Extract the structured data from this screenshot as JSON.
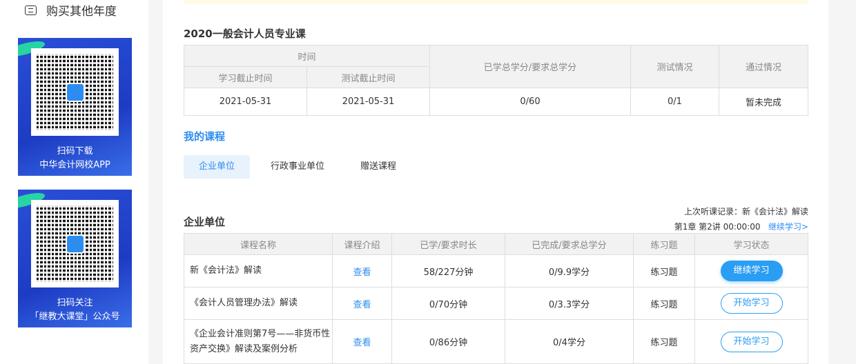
{
  "sidebar": {
    "buy_other": "购买其他年度",
    "qr1": {
      "line1": "扫码下载",
      "line2": "中华会计网校APP"
    },
    "qr2": {
      "line1": "扫码关注",
      "line2": "「继教大课堂」公众号"
    }
  },
  "summary": {
    "title": "2020一般会计人员专业课",
    "headers": {
      "time": "时间",
      "study_deadline": "学习截止时间",
      "test_deadline": "测试截止时间",
      "credits": "已学总学分/要求总学分",
      "test": "测试情况",
      "pass": "通过情况"
    },
    "row": {
      "study_deadline": "2021-05-31",
      "test_deadline": "2021-05-31",
      "credits": "0/60",
      "test": "0/1",
      "pass": "暂未完成"
    }
  },
  "my_courses": {
    "title": "我的课程",
    "tabs": [
      "企业单位",
      "行政事业单位",
      "赠送课程"
    ]
  },
  "section": {
    "title": "企业单位",
    "last_record_label": "上次听课记录：新《会计法》解读",
    "last_pos": "第1章  第2讲  00:00:00",
    "continue_link": "继续学习>"
  },
  "courses": {
    "headers": [
      "课程名称",
      "课程介绍",
      "已学/要求时长",
      "已完成/要求总学分",
      "练习题",
      "学习状态"
    ],
    "rows": [
      {
        "name": "新《会计法》解读",
        "intro": "查看",
        "time": "58/227分钟",
        "credits": "0/9.9学分",
        "exercise": "练习题",
        "status": "继续学习",
        "active": true
      },
      {
        "name": "《会计人员管理办法》解读",
        "intro": "查看",
        "time": "0/70分钟",
        "credits": "0/3.3学分",
        "exercise": "练习题",
        "status": "开始学习",
        "active": false
      },
      {
        "name": "《企业会计准则第7号——非货币性资产交换》解读及案例分析",
        "intro": "查看",
        "time": "0/86分钟",
        "credits": "0/4学分",
        "exercise": "练习题",
        "status": "开始学习",
        "active": false
      }
    ]
  }
}
